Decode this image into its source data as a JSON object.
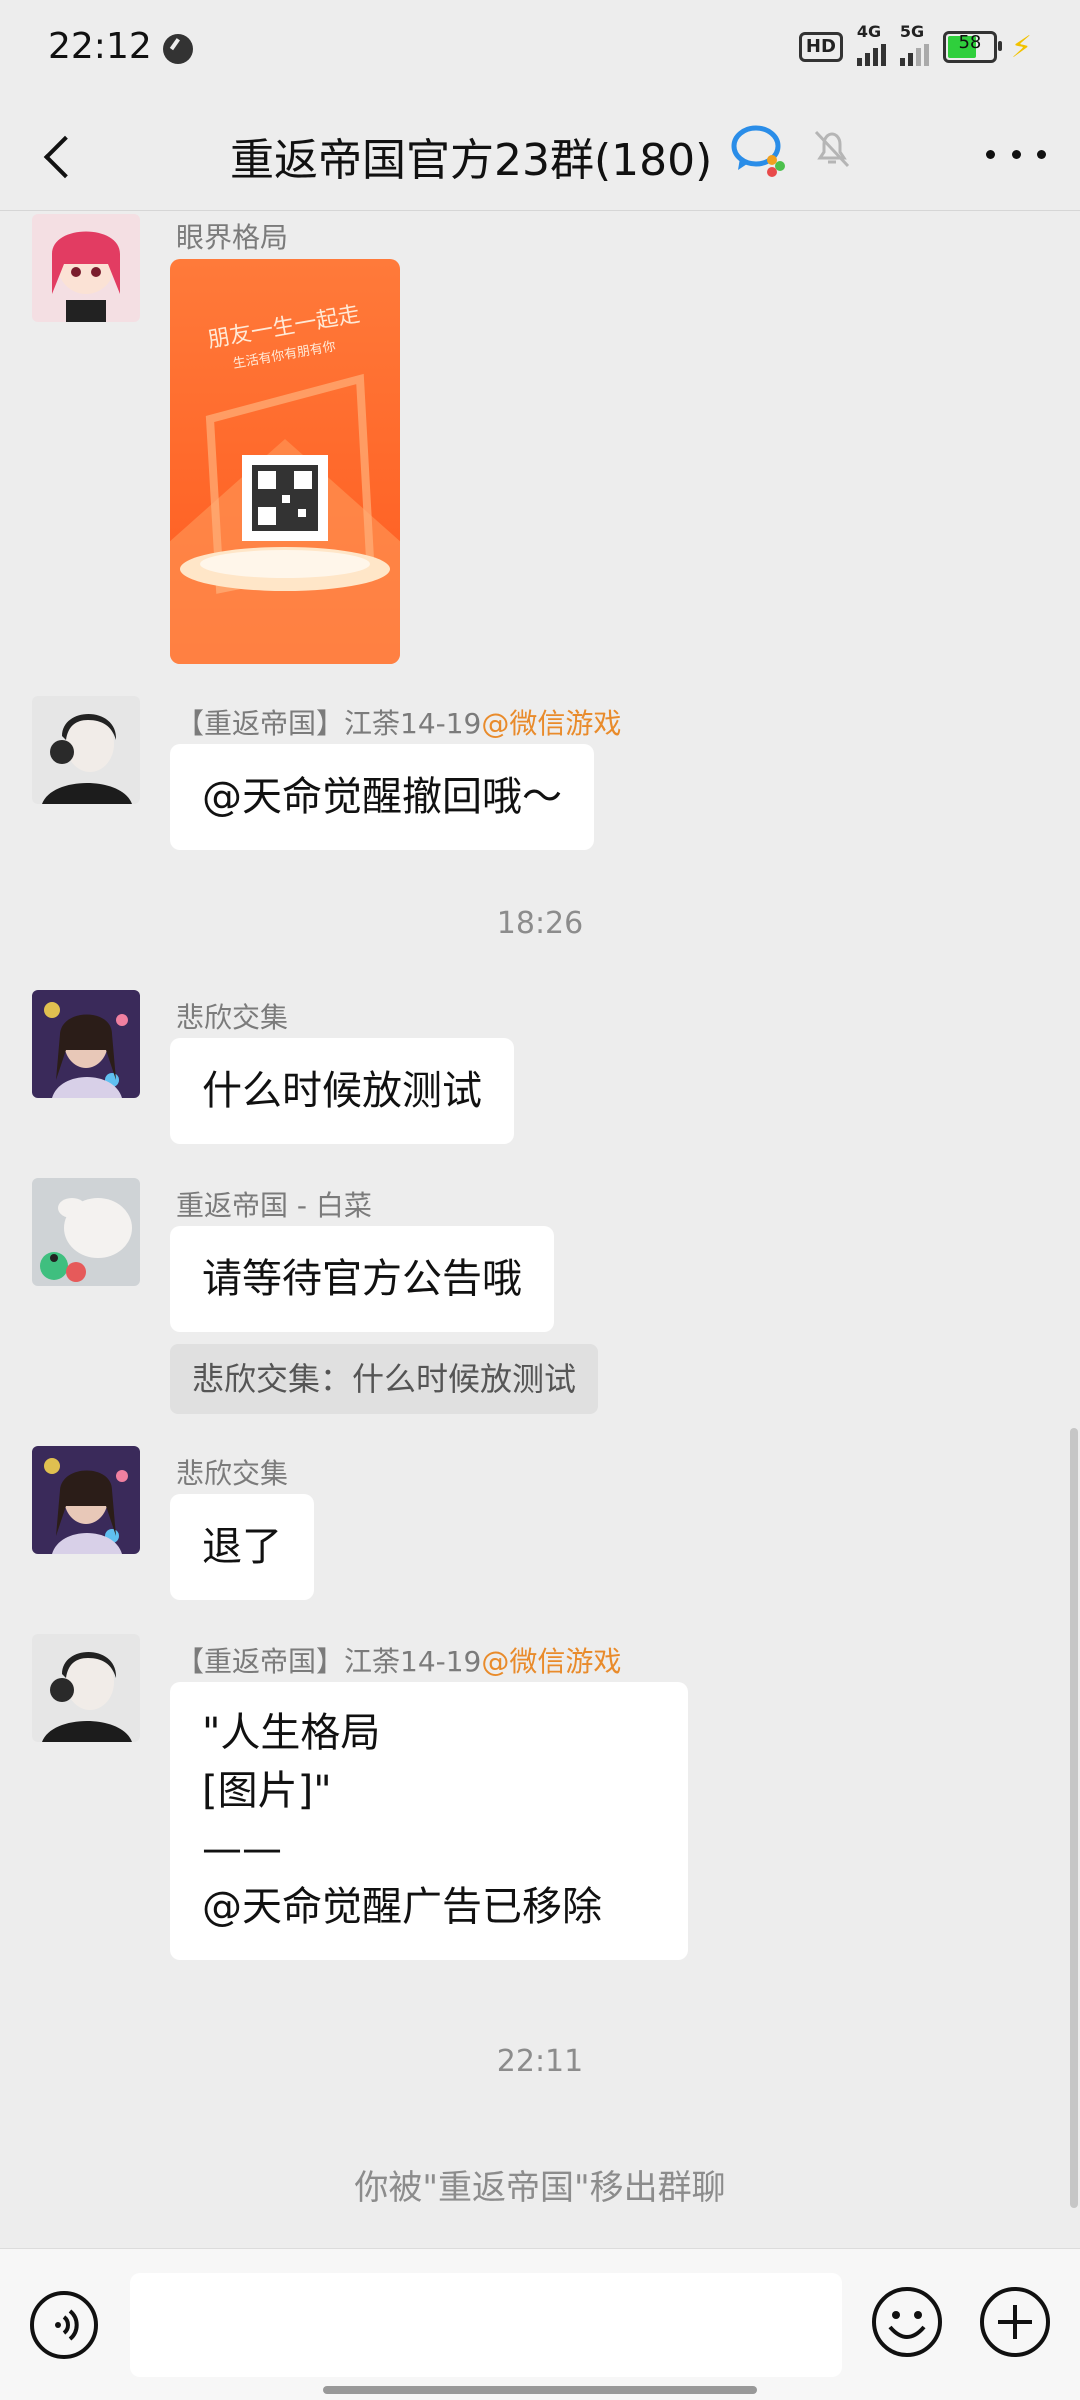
{
  "status_bar": {
    "time": "22:12",
    "hd": "HD",
    "net1": "4G",
    "net2": "5G",
    "battery": "58"
  },
  "header": {
    "title": "重返帝国官方23群(180)"
  },
  "messages": [
    {
      "type": "image",
      "sender": "眼界格局",
      "image_text_top": "朋友一生一起走",
      "image_text_sub": "生活有你有朋有你"
    },
    {
      "type": "text",
      "sender": "【重返帝国】江荼14-19",
      "sender_tag": "@微信游戏",
      "text": "@天命觉醒撤回哦～"
    },
    {
      "type": "time",
      "text": "18:26"
    },
    {
      "type": "text",
      "sender": "悲欣交集",
      "text": "什么时候放测试"
    },
    {
      "type": "text",
      "sender": "重返帝国 - 白菜",
      "text": "请等待官方公告哦",
      "quote": "悲欣交集：什么时候放测试"
    },
    {
      "type": "text",
      "sender": "悲欣交集",
      "text": "退了"
    },
    {
      "type": "text",
      "sender": "【重返帝国】江荼14-19",
      "sender_tag": "@微信游戏",
      "lines": [
        "\"人生格局",
        "[图片]\"",
        "——",
        "@天命觉醒广告已移除"
      ]
    },
    {
      "type": "time",
      "text": "22:11"
    },
    {
      "type": "system",
      "text": "你被\"重返帝国\"移出群聊"
    }
  ],
  "input": {
    "value": "",
    "placeholder": ""
  },
  "icons": [
    "back-icon",
    "wechat-bubble-icon",
    "mute-bell-icon",
    "more-icon",
    "voice-icon",
    "emoji-icon",
    "plus-icon"
  ],
  "colors": {
    "background": "#ededed",
    "bubble": "#ffffff",
    "tag": "#e98b2b"
  }
}
